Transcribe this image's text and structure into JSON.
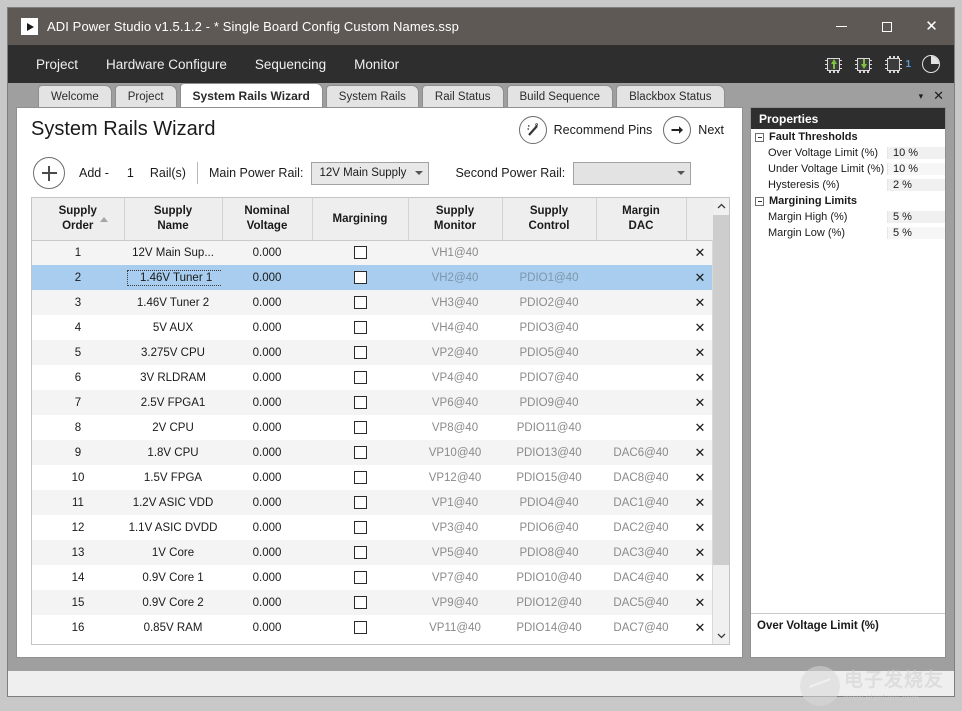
{
  "window": {
    "title": "ADI Power Studio v1.5.1.2 - * Single Board Config Custom Names.ssp",
    "app_icon": "play-icon",
    "minimize_label": "—",
    "maximize_label": "□",
    "close_label": "✕"
  },
  "menubar": {
    "items": [
      {
        "label": "Project"
      },
      {
        "label": "Hardware Configure"
      },
      {
        "label": "Sequencing"
      },
      {
        "label": "Monitor"
      }
    ],
    "tools": [
      {
        "name": "upload-to-device-icon",
        "badge": ""
      },
      {
        "name": "download-from-device-icon",
        "badge": ""
      },
      {
        "name": "device-count-icon",
        "badge": "1"
      },
      {
        "name": "telemetry-pie-icon",
        "badge": ""
      }
    ]
  },
  "tabs": {
    "items": [
      {
        "label": "Welcome",
        "active": false
      },
      {
        "label": "Project",
        "active": false
      },
      {
        "label": "System Rails Wizard",
        "active": true
      },
      {
        "label": "System Rails",
        "active": false
      },
      {
        "label": "Rail Status",
        "active": false
      },
      {
        "label": "Build Sequence",
        "active": false
      },
      {
        "label": "Blackbox Status",
        "active": false
      }
    ],
    "dropdown_glyph": "▾",
    "close_glyph": "✕"
  },
  "page": {
    "title": "System Rails Wizard",
    "recommend_pins_label": "Recommend Pins",
    "recommend_pins_icon": "magic-wand-icon",
    "next_label": "Next",
    "next_icon": "arrow-right-icon"
  },
  "addbar": {
    "add_icon": "plus-icon",
    "add_label": "Add -",
    "count_value": "1",
    "rails_label": "Rail(s)",
    "main_power_rail_label": "Main Power Rail:",
    "main_power_rail_value": "12V Main Supply",
    "second_power_rail_label": "Second Power Rail:",
    "second_power_rail_value": ""
  },
  "table": {
    "columns": [
      {
        "line1": "Supply",
        "line2": "Order",
        "sorted": true
      },
      {
        "line1": "Supply",
        "line2": "Name",
        "sorted": false
      },
      {
        "line1": "Nominal",
        "line2": "Voltage",
        "sorted": false
      },
      {
        "line1": "Margining",
        "line2": "",
        "sorted": false
      },
      {
        "line1": "Supply",
        "line2": "Monitor",
        "sorted": false
      },
      {
        "line1": "Supply",
        "line2": "Control",
        "sorted": false
      },
      {
        "line1": "Margin",
        "line2": "DAC",
        "sorted": false
      },
      {
        "line1": "",
        "line2": "",
        "sorted": false
      }
    ],
    "delete_glyph": "✕",
    "rows": [
      {
        "order": "1",
        "name": "12V Main Sup...",
        "voltage": "0.000",
        "margining": false,
        "monitor": "VH1@40",
        "control": "",
        "dac": "",
        "selected": false
      },
      {
        "order": "2",
        "name": "1.46V Tuner 1",
        "voltage": "0.000",
        "margining": false,
        "monitor": "VH2@40",
        "control": "PDIO1@40",
        "dac": "",
        "selected": true
      },
      {
        "order": "3",
        "name": "1.46V Tuner 2",
        "voltage": "0.000",
        "margining": false,
        "monitor": "VH3@40",
        "control": "PDIO2@40",
        "dac": "",
        "selected": false
      },
      {
        "order": "4",
        "name": "5V AUX",
        "voltage": "0.000",
        "margining": false,
        "monitor": "VH4@40",
        "control": "PDIO3@40",
        "dac": "",
        "selected": false
      },
      {
        "order": "5",
        "name": "3.275V CPU",
        "voltage": "0.000",
        "margining": false,
        "monitor": "VP2@40",
        "control": "PDIO5@40",
        "dac": "",
        "selected": false
      },
      {
        "order": "6",
        "name": "3V RLDRAM",
        "voltage": "0.000",
        "margining": false,
        "monitor": "VP4@40",
        "control": "PDIO7@40",
        "dac": "",
        "selected": false
      },
      {
        "order": "7",
        "name": "2.5V FPGA1",
        "voltage": "0.000",
        "margining": false,
        "monitor": "VP6@40",
        "control": "PDIO9@40",
        "dac": "",
        "selected": false
      },
      {
        "order": "8",
        "name": "2V CPU",
        "voltage": "0.000",
        "margining": false,
        "monitor": "VP8@40",
        "control": "PDIO11@40",
        "dac": "",
        "selected": false
      },
      {
        "order": "9",
        "name": "1.8V CPU",
        "voltage": "0.000",
        "margining": false,
        "monitor": "VP10@40",
        "control": "PDIO13@40",
        "dac": "DAC6@40",
        "selected": false
      },
      {
        "order": "10",
        "name": "1.5V FPGA",
        "voltage": "0.000",
        "margining": false,
        "monitor": "VP12@40",
        "control": "PDIO15@40",
        "dac": "DAC8@40",
        "selected": false
      },
      {
        "order": "11",
        "name": "1.2V ASIC VDD",
        "voltage": "0.000",
        "margining": false,
        "monitor": "VP1@40",
        "control": "PDIO4@40",
        "dac": "DAC1@40",
        "selected": false
      },
      {
        "order": "12",
        "name": "1.1V ASIC DVDD",
        "voltage": "0.000",
        "margining": false,
        "monitor": "VP3@40",
        "control": "PDIO6@40",
        "dac": "DAC2@40",
        "selected": false
      },
      {
        "order": "13",
        "name": "1V Core",
        "voltage": "0.000",
        "margining": false,
        "monitor": "VP5@40",
        "control": "PDIO8@40",
        "dac": "DAC3@40",
        "selected": false
      },
      {
        "order": "14",
        "name": "0.9V Core 1",
        "voltage": "0.000",
        "margining": false,
        "monitor": "VP7@40",
        "control": "PDIO10@40",
        "dac": "DAC4@40",
        "selected": false
      },
      {
        "order": "15",
        "name": "0.9V Core 2",
        "voltage": "0.000",
        "margining": false,
        "monitor": "VP9@40",
        "control": "PDIO12@40",
        "dac": "DAC5@40",
        "selected": false
      },
      {
        "order": "16",
        "name": "0.85V RAM",
        "voltage": "0.000",
        "margining": false,
        "monitor": "VP11@40",
        "control": "PDIO14@40",
        "dac": "DAC7@40",
        "selected": false
      }
    ],
    "scroll_up_glyph": "⌃",
    "scroll_down_glyph": "⌄"
  },
  "properties": {
    "title": "Properties",
    "groups": [
      {
        "label": "Fault Thresholds",
        "rows": [
          {
            "name": "Over Voltage Limit (%)",
            "value": "10 %"
          },
          {
            "name": "Under Voltage Limit (%)",
            "value": "10 %"
          },
          {
            "name": "Hysteresis (%)",
            "value": "2 %"
          }
        ]
      },
      {
        "label": "Margining Limits",
        "rows": [
          {
            "name": "Margin High (%)",
            "value": "5 %"
          },
          {
            "name": "Margin Low (%)",
            "value": "5 %"
          }
        ]
      }
    ],
    "footer_title": "Over Voltage Limit (%)"
  },
  "watermark": {
    "cn_text": "电子发烧友",
    "url_text": "www.elecfans.com"
  },
  "colors": {
    "titlebar": "#5e5955",
    "menubar": "#2e2e2e",
    "window_chrome": "#9f9f9f",
    "selection_blue": "#a8cdee",
    "accent_green": "#7ec13c",
    "header_grey": "#eeeeee"
  }
}
